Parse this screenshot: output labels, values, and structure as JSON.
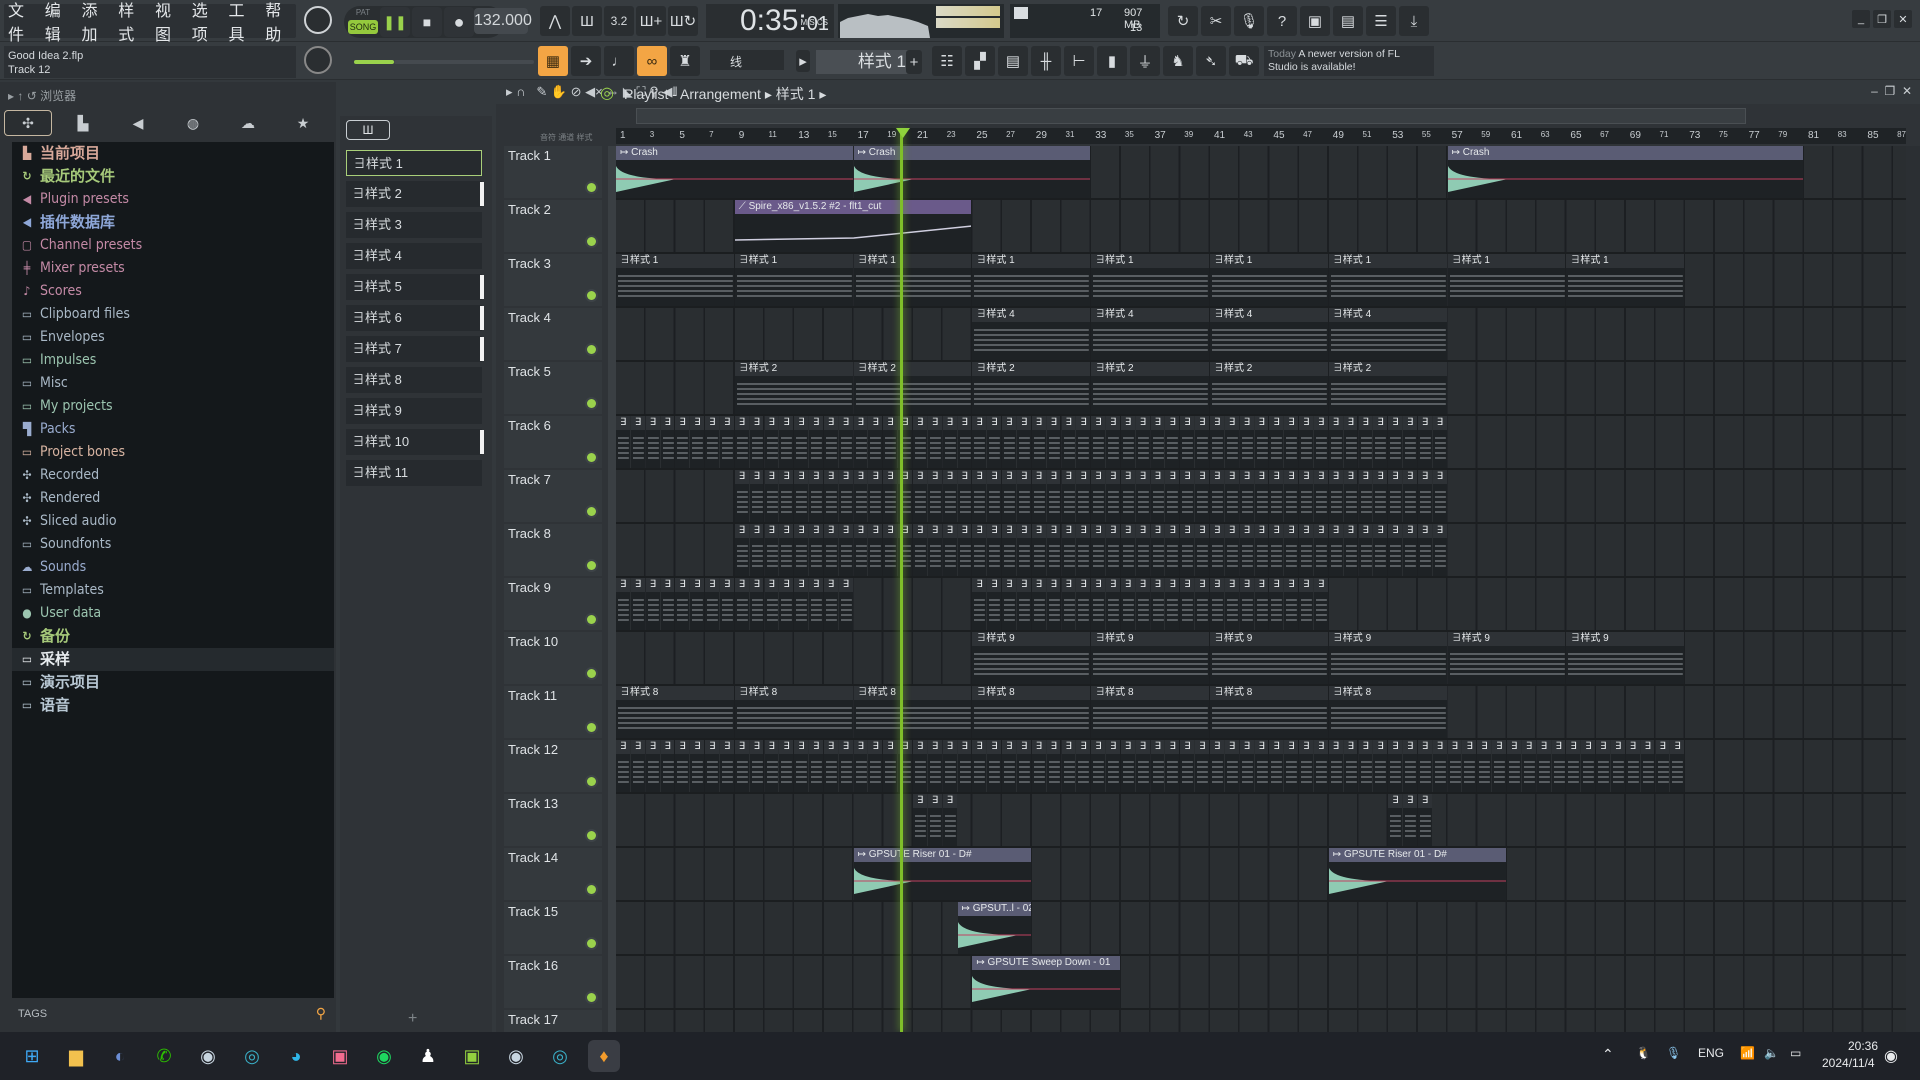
{
  "menu": [
    "文件",
    "编辑",
    "添加",
    "样式",
    "视图",
    "选项",
    "工具",
    "帮助"
  ],
  "transport": {
    "pat": "PAT",
    "song": "SONG",
    "tempo": "132.000",
    "time_main": "0:35",
    "time_cs": "01",
    "time_unit": "M:S:CS",
    "cpu_count": "17",
    "memory": "907 MB",
    "poly": "13"
  },
  "project": {
    "file": "Good Idea 2.flp",
    "hint": "Track 12"
  },
  "snap": "线",
  "pattern_selector": "样式 1",
  "news": {
    "when": "Today",
    "text": "A newer version of FL Studio is available!"
  },
  "browser": {
    "title": "浏览器",
    "tabs": [
      "all-icon",
      "file-icon",
      "plugin-icon",
      "globe-icon",
      "cloud-icon",
      "star-icon"
    ],
    "items": [
      {
        "label": "当前项目",
        "icon": "▙",
        "color": "#d8a99a",
        "big": true
      },
      {
        "label": "最近的文件",
        "icon": "↻",
        "color": "#a6c97a",
        "big": true
      },
      {
        "label": "Plugin presets",
        "icon": "◀",
        "color": "#c48aa6"
      },
      {
        "label": "插件数据库",
        "icon": "◀",
        "color": "#8ea7d8",
        "big": true
      },
      {
        "label": "Channel presets",
        "icon": "▢",
        "color": "#c48aa6"
      },
      {
        "label": "Mixer presets",
        "icon": "╪",
        "color": "#c48aa6"
      },
      {
        "label": "Scores",
        "icon": "♪",
        "color": "#c48aa6"
      },
      {
        "label": "Clipboard files",
        "icon": "▭",
        "color": "#a9b8c6"
      },
      {
        "label": "Envelopes",
        "icon": "▭",
        "color": "#a9b8c6"
      },
      {
        "label": "Impulses",
        "icon": "▭",
        "color": "#9cc5b0"
      },
      {
        "label": "Misc",
        "icon": "▭",
        "color": "#a9b8c6"
      },
      {
        "label": "My projects",
        "icon": "▭",
        "color": "#9cc5b0"
      },
      {
        "label": "Packs",
        "icon": "▜",
        "color": "#9aaccf"
      },
      {
        "label": "Project bones",
        "icon": "▭",
        "color": "#d8b4a2"
      },
      {
        "label": "Recorded",
        "icon": "✣",
        "color": "#a9b8c6"
      },
      {
        "label": "Rendered",
        "icon": "✣",
        "color": "#a9b8c6"
      },
      {
        "label": "Sliced audio",
        "icon": "✣",
        "color": "#a9b8c6"
      },
      {
        "label": "Soundfonts",
        "icon": "▭",
        "color": "#a9b8c6"
      },
      {
        "label": "Sounds",
        "icon": "☁",
        "color": "#9aaccf"
      },
      {
        "label": "Templates",
        "icon": "▭",
        "color": "#a9b8c6"
      },
      {
        "label": "User data",
        "icon": "●",
        "color": "#9cc5b0"
      },
      {
        "label": "备份",
        "icon": "↻",
        "color": "#a6c97a",
        "big": true
      },
      {
        "label": "采样",
        "icon": "▭",
        "color": "#e8ecef",
        "big": true,
        "selected": true
      },
      {
        "label": "演示项目",
        "icon": "▭",
        "color": "#b9c8d4",
        "big": true
      },
      {
        "label": "语音",
        "icon": "▭",
        "color": "#b9c8d4",
        "big": true
      }
    ],
    "tags_label": "TAGS"
  },
  "patterns": [
    "样式 1",
    "样式 2",
    "样式 3",
    "样式 4",
    "样式 5",
    "样式 6",
    "样式 7",
    "样式 8",
    "样式 9",
    "样式 10",
    "样式 11"
  ],
  "playlist": {
    "title": "Playlist - Arrangement",
    "current": "样式 1",
    "col_labels": [
      "音符",
      "通道",
      "样式"
    ],
    "ruler": [
      "1",
      "3",
      "5",
      "7",
      "9",
      "11",
      "13",
      "15",
      "17",
      "19",
      "21",
      "23",
      "25",
      "27",
      "29",
      "31",
      "33",
      "35",
      "37",
      "39",
      "41",
      "43",
      "45",
      "47",
      "49",
      "51",
      "53",
      "55",
      "57",
      "59",
      "61",
      "63",
      "65",
      "67",
      "69",
      "71",
      "73",
      "75",
      "77",
      "79",
      "81",
      "83",
      "85",
      "87"
    ],
    "tracks": [
      "Track 1",
      "Track 2",
      "Track 3",
      "Track 4",
      "Track 5",
      "Track 6",
      "Track 7",
      "Track 8",
      "Track 9",
      "Track 10",
      "Track 11",
      "Track 12",
      "Track 13",
      "Track 14",
      "Track 15",
      "Track 16",
      "Track 17"
    ],
    "clips": [
      {
        "track": 0,
        "start": 1,
        "len": 16,
        "label": "Crash",
        "kind": "audio"
      },
      {
        "track": 0,
        "start": 17,
        "len": 16,
        "label": "Crash",
        "kind": "audio"
      },
      {
        "track": 0,
        "start": 57,
        "len": 24,
        "label": "Crash",
        "kind": "audio"
      },
      {
        "track": 1,
        "start": 9,
        "len": 16,
        "label": "Spire_x86_v1.5.2 #2 - flt1_cut",
        "kind": "auto"
      },
      {
        "track": 2,
        "start": 1,
        "len": 8,
        "label": "样式 1",
        "kind": "pat",
        "repeat": 9
      },
      {
        "track": 3,
        "start": 25,
        "len": 8,
        "label": "样式 4",
        "kind": "pat",
        "repeat": 4
      },
      {
        "track": 4,
        "start": 9,
        "len": 8,
        "label": "样式 2",
        "kind": "pat",
        "repeat": 6
      },
      {
        "track": 5,
        "start": 1,
        "len": 1,
        "label": "",
        "kind": "pat",
        "repeat": 56
      },
      {
        "track": 6,
        "start": 9,
        "len": 1,
        "label": "",
        "kind": "pat",
        "repeat": 48
      },
      {
        "track": 7,
        "start": 9,
        "len": 1,
        "label": "",
        "kind": "pat",
        "repeat": 48
      },
      {
        "track": 8,
        "start": 1,
        "len": 1,
        "label": "",
        "kind": "pat",
        "repeat": 16
      },
      {
        "track": 8,
        "start": 25,
        "len": 1,
        "label": "",
        "kind": "pat",
        "repeat": 24
      },
      {
        "track": 9,
        "start": 25,
        "len": 8,
        "label": "样式 9",
        "kind": "pat",
        "repeat": 6
      },
      {
        "track": 10,
        "start": 1,
        "len": 8,
        "label": "样式 8",
        "kind": "pat",
        "repeat": 7
      },
      {
        "track": 11,
        "start": 1,
        "len": 1,
        "label": "",
        "kind": "pat",
        "repeat": 72
      },
      {
        "track": 12,
        "start": 21,
        "len": 1,
        "label": "",
        "kind": "pat",
        "repeat": 3
      },
      {
        "track": 12,
        "start": 53,
        "len": 1,
        "label": "",
        "kind": "pat",
        "repeat": 3
      },
      {
        "track": 13,
        "start": 17,
        "len": 12,
        "label": "GPSUTE Riser 01 - D#",
        "kind": "audio"
      },
      {
        "track": 13,
        "start": 49,
        "len": 12,
        "label": "GPSUTE Riser 01 - D#",
        "kind": "audio"
      },
      {
        "track": 14,
        "start": 24,
        "len": 5,
        "label": "GPSUT..l - 02",
        "kind": "audio"
      },
      {
        "track": 15,
        "start": 25,
        "len": 10,
        "label": "GPSUTE Sweep Down - 01",
        "kind": "audio"
      }
    ]
  },
  "taskbar": {
    "apps": [
      "windows-start",
      "file-explorer",
      "app-circle",
      "wechat",
      "steam",
      "app-ring",
      "edge",
      "bilibili",
      "spotify",
      "qq",
      "kook",
      "steam-2",
      "app-ring-2",
      "fl-studio"
    ],
    "lang": "ENG",
    "time": "20:36",
    "date": "2024/11/4"
  }
}
